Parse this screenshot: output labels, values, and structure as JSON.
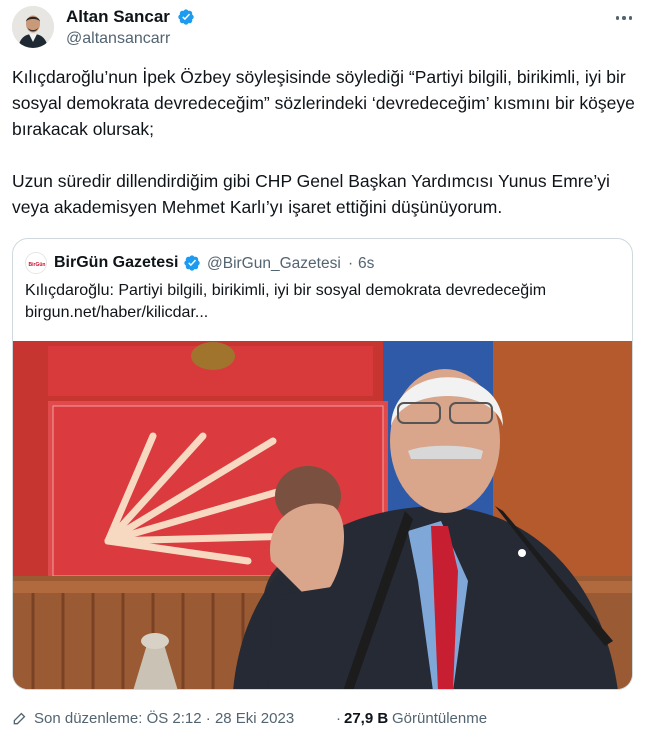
{
  "author": {
    "name": "Altan Sancar",
    "handle": "@altansancarr",
    "verified": true
  },
  "menu": {
    "icon": "more-horizontal-icon"
  },
  "tweet": {
    "paragraphs": [
      "Kılıçdaroğlu’nun İpek Özbey söyleşisinde söylediği “Partiyi bilgili, birikimli, iyi bir sosyal demokrata devredeceğim” sözlerindeki ‘devredeceğim’ kısmını bir köşeye bırakacak olursak;",
      "Uzun süredir dillendirdiğim gibi CHP Genel Başkan Yardımcısı Yunus Emre’yi veya akademisyen Mehmet Karlı’yı işaret ettiğini düşünüyorum."
    ]
  },
  "quote": {
    "logo_text": "BirGün",
    "name": "BirGün Gazetesi",
    "verified": true,
    "handle": "@BirGun_Gazetesi",
    "separator": "·",
    "time": "6s",
    "text": "Kılıçdaroğlu: Partiyi bilgili, birikimli, iyi bir sosyal demokrata devredeceğim",
    "link": "birgun.net/haber/kilicdar..."
  },
  "footer": {
    "edit_label": "Son düzenleme: ÖS 2:12 · 28 Eki 2023",
    "separator": "·",
    "views_count": "27,9 B",
    "views_label": "Görüntülenme"
  },
  "colors": {
    "text": "#0f1419",
    "secondary": "#536471",
    "verified": "#1d9bf0",
    "border": "#cfd9de",
    "party_red": "#d7272f"
  }
}
